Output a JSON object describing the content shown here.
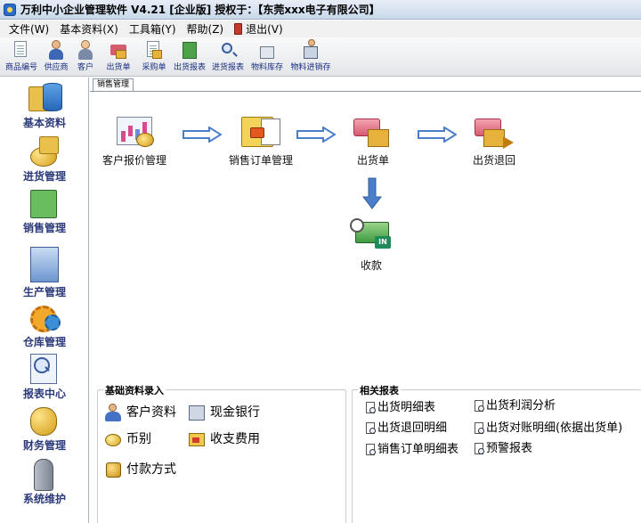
{
  "window": {
    "title": "万利中小企业管理软件 V4.21 [企业版]  授权于：【东莞xxx电子有限公司】"
  },
  "menu": {
    "items": [
      "文件(W)",
      "基本资料(X)",
      "工具箱(Y)",
      "帮助(Z)",
      "退出(V)"
    ]
  },
  "toolbar": {
    "buttons": [
      "商品编号",
      "供应商",
      "客户",
      "出货单",
      "采购单",
      "出货报表",
      "进货报表",
      "物料库存",
      "物料进销存"
    ]
  },
  "sidebar": {
    "items": [
      "基本资料",
      "进货管理",
      "销售管理",
      "生产管理",
      "仓库管理",
      "报表中心",
      "财务管理",
      "系统维护"
    ]
  },
  "main": {
    "active_tab": "销售管理"
  },
  "flow": {
    "quote": "客户报价管理",
    "order": "销售订单管理",
    "ship": "出货单",
    "return": "出货退回",
    "receive": "收款"
  },
  "basic_entry": {
    "title": "基础资料录入",
    "customer": "客户资料",
    "cash_bank": "现金银行",
    "currency": "币别",
    "income_expense": "收支费用",
    "payment": "付款方式"
  },
  "reports": {
    "title": "相关报表",
    "ship_detail": "出货明细表",
    "profit": "出货利润分析",
    "return_detail": "出货退回明细",
    "reconcile": "出货对账明细(依据出货单)",
    "order_detail": "销售订单明细表",
    "warning": "预警报表"
  },
  "colors": {
    "accent_text": "#2b3a7a",
    "toolbar_label": "#1a2f80",
    "flow_arrow": "#4a7ec9"
  }
}
